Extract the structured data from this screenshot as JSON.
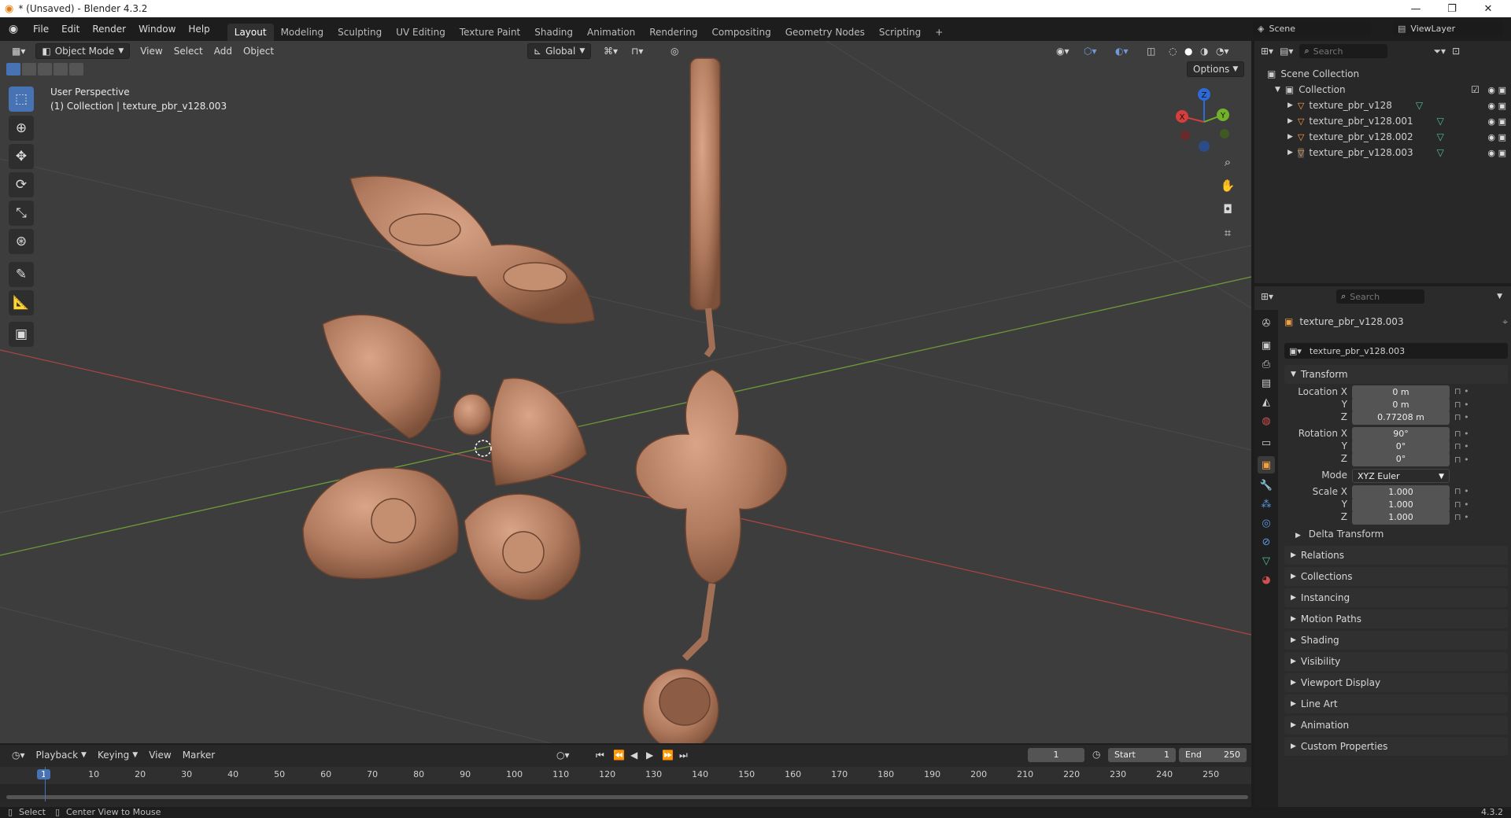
{
  "window": {
    "title": "* (Unsaved) - Blender 4.3.2",
    "minimize": "—",
    "maximize": "❐",
    "close": "✕"
  },
  "menu": [
    "File",
    "Edit",
    "Render",
    "Window",
    "Help"
  ],
  "workspaces": [
    "Layout",
    "Modeling",
    "Sculpting",
    "UV Editing",
    "Texture Paint",
    "Shading",
    "Animation",
    "Rendering",
    "Compositing",
    "Geometry Nodes",
    "Scripting"
  ],
  "workspace_add": "+",
  "scene": {
    "name": "Scene",
    "view_layer": "ViewLayer"
  },
  "viewport": {
    "mode": "Object Mode",
    "menus": [
      "View",
      "Select",
      "Add",
      "Object"
    ],
    "orientation": "Global",
    "options": "Options",
    "info_line1": "User Perspective",
    "info_line2": "(1) Collection | texture_pbr_v128.003",
    "gizmo": {
      "z": "Z",
      "x": "X",
      "y": "Y"
    }
  },
  "outliner": {
    "search_placeholder": "Search",
    "scene_collection": "Scene Collection",
    "collection": "Collection",
    "objects": [
      "texture_pbr_v128",
      "texture_pbr_v128.001",
      "texture_pbr_v128.002",
      "texture_pbr_v128.003"
    ]
  },
  "properties": {
    "search_placeholder": "Search",
    "object_name": "texture_pbr_v128.003",
    "object_field": "texture_pbr_v128.003",
    "transform_header": "Transform",
    "location_label": "Location X",
    "location": [
      "0 m",
      "0 m",
      "0.77208 m"
    ],
    "rotation_label": "Rotation X",
    "rotation": [
      "90°",
      "0°",
      "0°"
    ],
    "mode_label": "Mode",
    "mode": "XYZ Euler",
    "scale_label": "Scale X",
    "scale": [
      "1.000",
      "1.000",
      "1.000"
    ],
    "axis_y": "Y",
    "axis_z": "Z",
    "delta": "Delta Transform",
    "panels": [
      "Relations",
      "Collections",
      "Instancing",
      "Motion Paths",
      "Shading",
      "Visibility",
      "Viewport Display",
      "Line Art",
      "Animation",
      "Custom Properties"
    ]
  },
  "timeline": {
    "menus": [
      "Playback",
      "Keying",
      "View",
      "Marker"
    ],
    "current_frame": "1",
    "start_label": "Start",
    "start": "1",
    "end_label": "End",
    "end": "250",
    "ruler": [
      "1",
      "10",
      "20",
      "30",
      "40",
      "50",
      "60",
      "70",
      "80",
      "90",
      "100",
      "110",
      "120",
      "130",
      "140",
      "150",
      "160",
      "170",
      "180",
      "190",
      "200",
      "210",
      "220",
      "230",
      "240",
      "250"
    ]
  },
  "status": {
    "select": "Select",
    "center": "Center View to Mouse",
    "version": "4.3.2"
  },
  "colors": {
    "accent": "#4772b3",
    "object": "#b07a5e",
    "x_axis": "#c24b4b",
    "y_axis": "#6e9a3a"
  }
}
